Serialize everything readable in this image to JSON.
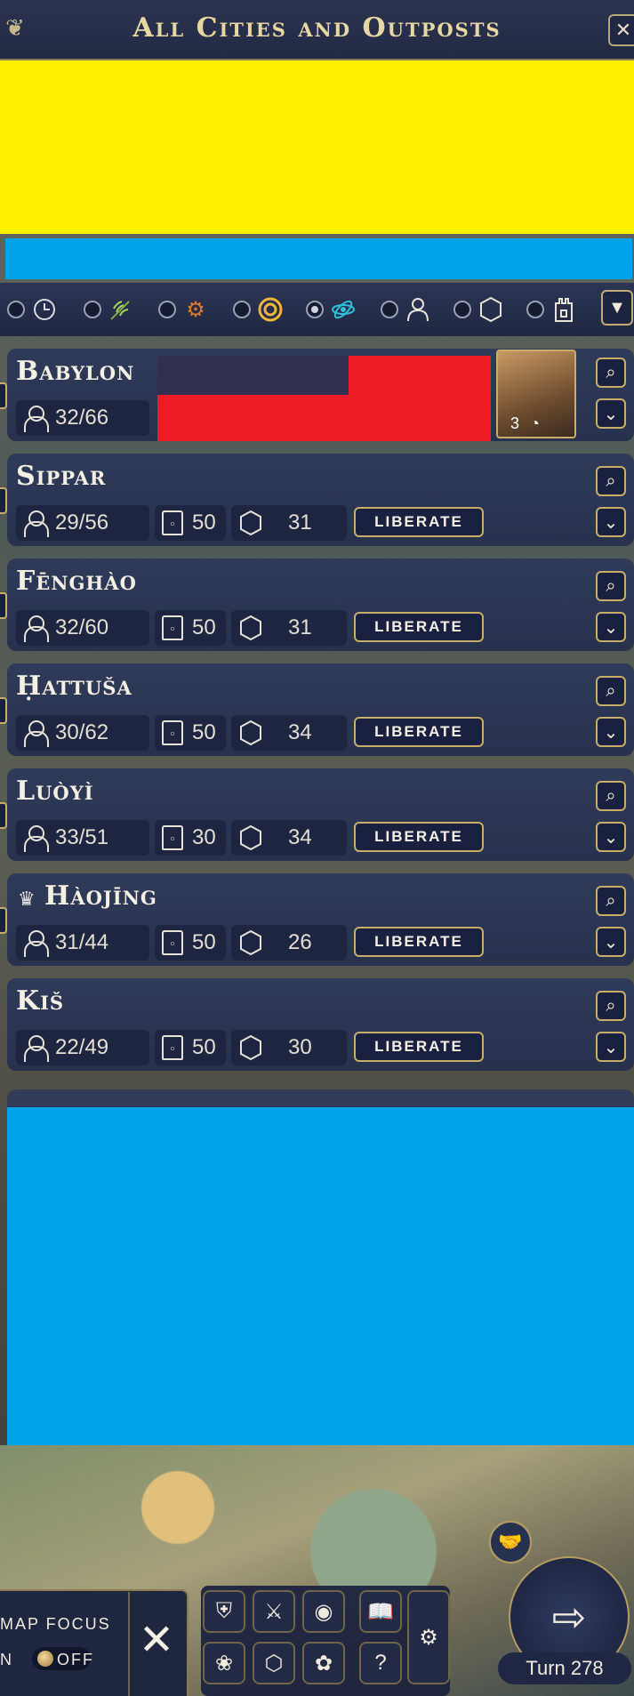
{
  "window": {
    "title": "All Cities and Outposts",
    "close_label": "✕"
  },
  "filters": [
    {
      "icon": "clock-icon",
      "selected": false
    },
    {
      "icon": "wheat-icon",
      "selected": false,
      "color": "#7fb04a"
    },
    {
      "icon": "gears-icon",
      "selected": false,
      "color": "#e07a2a"
    },
    {
      "icon": "coin-icon",
      "selected": false,
      "color": "#f0b53a"
    },
    {
      "icon": "science-icon",
      "selected": true,
      "color": "#31c0d8"
    },
    {
      "icon": "population-icon",
      "selected": false
    },
    {
      "icon": "hexagon-icon",
      "selected": false
    },
    {
      "icon": "tower-icon",
      "selected": false
    }
  ],
  "liberate_label": "LIBERATE",
  "cities": [
    {
      "name": "Babylon",
      "population": "32/66",
      "unit_turns": "3"
    },
    {
      "name": "Sippar",
      "population": "29/56",
      "defense": "50",
      "tiles": "31"
    },
    {
      "name": "Fēnghào",
      "population": "32/60",
      "defense": "50",
      "tiles": "31"
    },
    {
      "name": "Ḥattuša",
      "population": "30/62",
      "defense": "50",
      "tiles": "34"
    },
    {
      "name": "Luòyì",
      "population": "33/51",
      "defense": "30",
      "tiles": "34"
    },
    {
      "name": "Hàojīng",
      "population": "31/44",
      "defense": "50",
      "tiles": "26",
      "capital": true
    },
    {
      "name": "Kiš",
      "population": "22/49",
      "defense": "50",
      "tiles": "30"
    }
  ],
  "map_focus": {
    "label": "MAP FOCUS",
    "state": "OFF",
    "left_fragment": "N"
  },
  "turn": {
    "label": "Turn 278"
  },
  "colors": {
    "accent_gold": "#c9ae6a",
    "panel_navy": "#2d385a",
    "redacted_yellow": "#fff200",
    "redacted_blue": "#00a2e8",
    "redacted_red": "#ed1c24"
  }
}
